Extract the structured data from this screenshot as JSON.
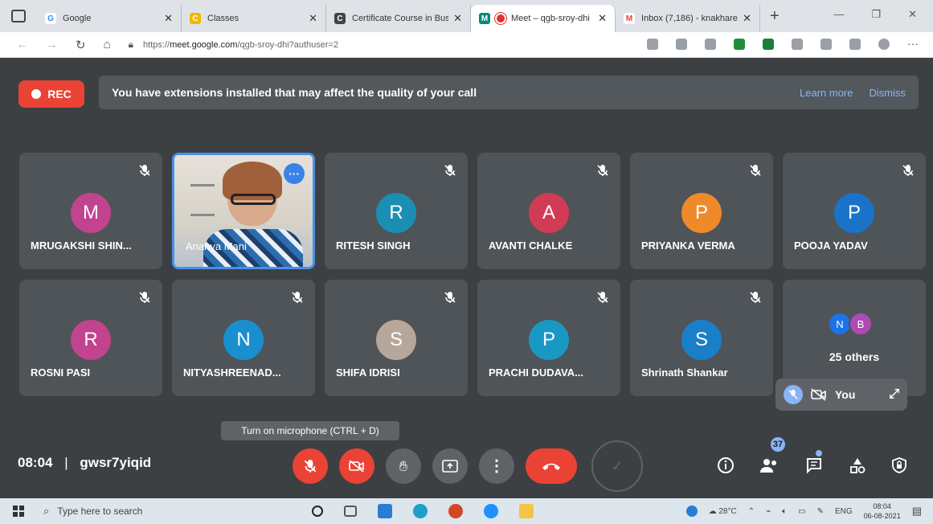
{
  "browser": {
    "tabs": [
      {
        "label": "Google",
        "favicon": "G",
        "color": "#4285f4"
      },
      {
        "label": "Classes",
        "favicon": "C",
        "color": "#f2b705"
      },
      {
        "label": "Certificate Course in Busi",
        "favicon": "C",
        "color": "#444444"
      },
      {
        "label": "Meet – qgb-sroy-dhi",
        "favicon": "M",
        "color": "#00897b"
      },
      {
        "label": "Inbox (7,186) - knakhare",
        "favicon": "M",
        "color": "#ea4335"
      }
    ],
    "url_prefix": "https://",
    "url_host": "meet.google.com",
    "url_path": "/qgb-sroy-dhi?authuser=2"
  },
  "meet": {
    "rec_label": "REC",
    "banner_text": "You have extensions installed that may affect the quality of your call",
    "banner_learn_more": "Learn more",
    "banner_dismiss": "Dismiss",
    "participants": [
      {
        "initial": "M",
        "name": "MRUGAKSHI SHIN...",
        "color": "#c2448f"
      },
      {
        "initial": "",
        "name": "Ananya Mani",
        "color": ""
      },
      {
        "initial": "R",
        "name": "RITESH SINGH",
        "color": "#1a8fb3"
      },
      {
        "initial": "A",
        "name": "AVANTI CHALKE",
        "color": "#d13b53"
      },
      {
        "initial": "P",
        "name": "PRIYANKA VERMA",
        "color": "#ee8a2a"
      },
      {
        "initial": "P",
        "name": "POOJA YADAV",
        "color": "#1a73c9"
      },
      {
        "initial": "R",
        "name": "ROSNI PASI",
        "color": "#c2448f"
      },
      {
        "initial": "N",
        "name": "NITYASHREENAD...",
        "color": "#1a8fd0"
      },
      {
        "initial": "S",
        "name": "SHIFA IDRISI",
        "color": "#b7a79a"
      },
      {
        "initial": "P",
        "name": "PRACHI DUDAVA...",
        "color": "#1a98c4"
      },
      {
        "initial": "S",
        "name": "Shrinath Shankar",
        "color": "#1a7fc9"
      }
    ],
    "others": {
      "avatars": [
        {
          "initial": "N",
          "color": "#1a73e8"
        },
        {
          "initial": "B",
          "color": "#b04ab3"
        }
      ],
      "label": "25 others"
    },
    "self_label": "You",
    "tooltip": "Turn on microphone (CTRL + D)",
    "time": "08:04",
    "meeting_code": "gwsr7yiqid",
    "people_count": "37"
  },
  "taskbar": {
    "search_placeholder": "Type here to search",
    "temperature": "28°C",
    "language": "ENG",
    "time": "08:04",
    "date": "06-08-2021"
  }
}
